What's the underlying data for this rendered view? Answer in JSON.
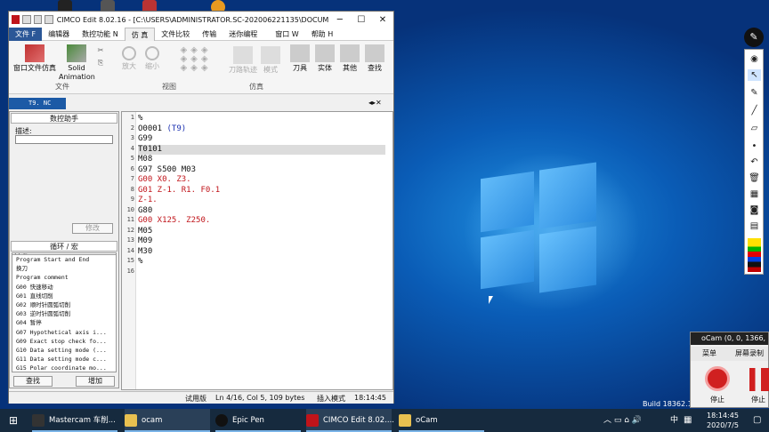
{
  "window": {
    "title": "CIMCO Edit 8.02.16 - [C:\\USERS\\ADMINISTRATOR.SC-202006221135\\DOCUMENT...",
    "minimize": "─",
    "maximize": "☐",
    "close": "✕"
  },
  "menu": {
    "file": "文件 F",
    "tabs": [
      "编辑器",
      "数控功能 N",
      "仿 真",
      "文件比较",
      "传输",
      "迷你编程"
    ],
    "right": [
      "窗口 W",
      "帮助 H"
    ]
  },
  "ribbon": {
    "window_sim": "窗口文件仿真",
    "solid_line1": "Solid",
    "solid_line2": "Animation",
    "group_file": "文件",
    "zoom_in": "放大",
    "zoom_out": "缩小",
    "group_view": "视图",
    "toolpath": "刀路轨迹",
    "mode": "模式",
    "group_sim": "仿真",
    "tool": "刀具",
    "solid": "实体",
    "other": "其他",
    "find": "查找"
  },
  "doc_tab": "T9. NC",
  "panel": {
    "title": "数控助手",
    "desc_label": "描述:",
    "modify_btn": "修改",
    "cycle_title": "循环 / 宏",
    "select_value": "缺省",
    "find_btn": "查找",
    "add_btn": "增加",
    "commands": [
      "Program Start and End",
      "换刀",
      "Program comment",
      "G00 快速移动",
      "G01 直线切削",
      "G02 顺时针圆弧切削",
      "G03 逆时针圆弧切削",
      "G04 暂停",
      "G07 Hypothetical axis i...",
      "G09 Exact stop check fo...",
      "G10 Data setting mode (...",
      "G11 Data setting mode c...",
      "G15 Polar coordinate mo..."
    ]
  },
  "code": [
    {
      "n": "1",
      "t": "%",
      "c": ""
    },
    {
      "n": "2",
      "t": "O0001 ",
      "t2": "(T9)",
      "c": ""
    },
    {
      "n": "3",
      "t": "G99",
      "c": ""
    },
    {
      "n": "4",
      "t": "T0101",
      "c": "hl"
    },
    {
      "n": "5",
      "t": "M08",
      "c": ""
    },
    {
      "n": "6",
      "t": "G97 S500 M03",
      "c": ""
    },
    {
      "n": "7",
      "t": "G00 X0. Z3.",
      "c": "red"
    },
    {
      "n": "8",
      "t": "G01 Z-1. R1. F0.1",
      "c": "red"
    },
    {
      "n": "9",
      "t": "Z-1.",
      "c": "red"
    },
    {
      "n": "10",
      "t": "G80",
      "c": ""
    },
    {
      "n": "11",
      "t": "G00 X125. Z250.",
      "c": "red"
    },
    {
      "n": "12",
      "t": "M05",
      "c": ""
    },
    {
      "n": "13",
      "t": "M09",
      "c": ""
    },
    {
      "n": "14",
      "t": "M30",
      "c": ""
    },
    {
      "n": "15",
      "t": "%",
      "c": ""
    },
    {
      "n": "16",
      "t": "",
      "c": ""
    }
  ],
  "status": {
    "trial": "试用版",
    "position": "Ln 4/16, Col 5, 109 bytes",
    "mode": "插入模式",
    "time": "18:14:45"
  },
  "ocam": {
    "title": "oCam (0, 0, 1366, 768)",
    "menu": "菜单",
    "record_screen": "屏幕录制",
    "stop": "停止",
    "pause": "停止"
  },
  "build": "Build 18362.19",
  "taskbar": {
    "items": [
      "Mastercam 车削...",
      "ocam",
      "Epic Pen",
      "CIMCO Edit 8.02....",
      "oCam"
    ],
    "ime": "中",
    "time": "18:14:45",
    "date": "2020/7/5"
  }
}
